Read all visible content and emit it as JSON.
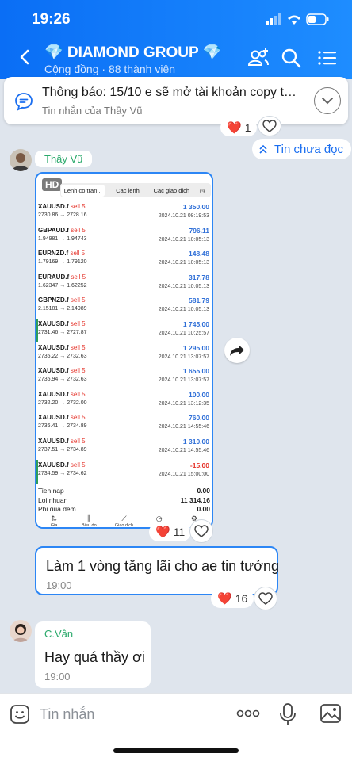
{
  "status": {
    "time": "19:26"
  },
  "header": {
    "title": "💎 DIAMOND GROUP 💎",
    "subtitle": "Cộng đồng · 88 thành viên"
  },
  "pinned": {
    "text": "Thông báo: 15/10 e sẽ mở tài khoản copy tr...",
    "from": "Tin nhắn của Thầy Vũ"
  },
  "top_reaction": {
    "heart": "❤️",
    "count": "1"
  },
  "unread_label": "Tin chưa đọc",
  "msg1": {
    "sender": "Thầy Vũ",
    "screenshot": {
      "hd": "HD",
      "tabs": [
        "Lenh co tran...",
        "Cac lenh",
        "Cac giao dich"
      ],
      "trades": [
        {
          "symbol": "XAUUSD.f",
          "side": "sell 5",
          "prices": "2730.86 → 2728.16",
          "profit": "1 350.00",
          "date": "2024.10.21 08:19:53",
          "bar": false
        },
        {
          "symbol": "GBPAUD.f",
          "side": "sell 5",
          "prices": "1.94981 → 1.94743",
          "profit": "796.11",
          "date": "2024.10.21 10:05:13",
          "bar": false
        },
        {
          "symbol": "EURNZD.f",
          "side": "sell 5",
          "prices": "1.79169 → 1.79120",
          "profit": "148.48",
          "date": "2024.10.21 10:05:13",
          "bar": false
        },
        {
          "symbol": "EURAUD.f",
          "side": "sell 5",
          "prices": "1.62347 → 1.62252",
          "profit": "317.78",
          "date": "2024.10.21 10:05:13",
          "bar": false
        },
        {
          "symbol": "GBPNZD.f",
          "side": "sell 5",
          "prices": "2.15181 → 2.14989",
          "profit": "581.79",
          "date": "2024.10.21 10:05:13",
          "bar": false
        },
        {
          "symbol": "XAUUSD.f",
          "side": "sell 5",
          "prices": "2731.46 → 2727.87",
          "profit": "1 745.00",
          "date": "2024.10.21 10:25:57",
          "bar": true
        },
        {
          "symbol": "XAUUSD.f",
          "side": "sell 5",
          "prices": "2735.22 → 2732.63",
          "profit": "1 295.00",
          "date": "2024.10.21 13:07:57",
          "bar": false
        },
        {
          "symbol": "XAUUSD.f",
          "side": "sell 5",
          "prices": "2735.94 → 2732.63",
          "profit": "1 655.00",
          "date": "2024.10.21 13:07:57",
          "bar": false
        },
        {
          "symbol": "XAUUSD.f",
          "side": "sell 5",
          "prices": "2732.20 → 2732.00",
          "profit": "100.00",
          "date": "2024.10.21 13:12:35",
          "bar": false
        },
        {
          "symbol": "XAUUSD.f",
          "side": "sell 5",
          "prices": "2736.41 → 2734.89",
          "profit": "760.00",
          "date": "2024.10.21 14:55:46",
          "bar": false
        },
        {
          "symbol": "XAUUSD.f",
          "side": "sell 5",
          "prices": "2737.51 → 2734.89",
          "profit": "1 310.00",
          "date": "2024.10.21 14:55:46",
          "bar": false
        },
        {
          "symbol": "XAUUSD.f",
          "side": "sell 5",
          "prices": "2734.59 → 2734.62",
          "profit": "-15.00",
          "date": "2024.10.21 15:00:00",
          "bar": true
        }
      ],
      "summary": [
        {
          "label": "Tien nap",
          "value": "0.00"
        },
        {
          "label": "Loi nhuan",
          "value": "11 314.16"
        },
        {
          "label": "Phi qua dem",
          "value": "0.00"
        }
      ],
      "bottom_tabs": [
        "Gia",
        "Bieu do",
        "Giao dich",
        "",
        ""
      ]
    },
    "reaction_count": "11"
  },
  "msg2": {
    "text": "Làm 1 vòng tăng lãi cho ae tin tưởng",
    "time": "19:00",
    "reaction_count": "16"
  },
  "msg3": {
    "sender": "C.Vân",
    "text": "Hay quá thầy ơi",
    "time": "19:00"
  },
  "composer": {
    "placeholder": "Tin nhắn"
  },
  "colors": {
    "header": "#1e8dff",
    "accent": "#1a6ef0",
    "profit": "#2f6fd7",
    "loss": "#e5332a"
  }
}
